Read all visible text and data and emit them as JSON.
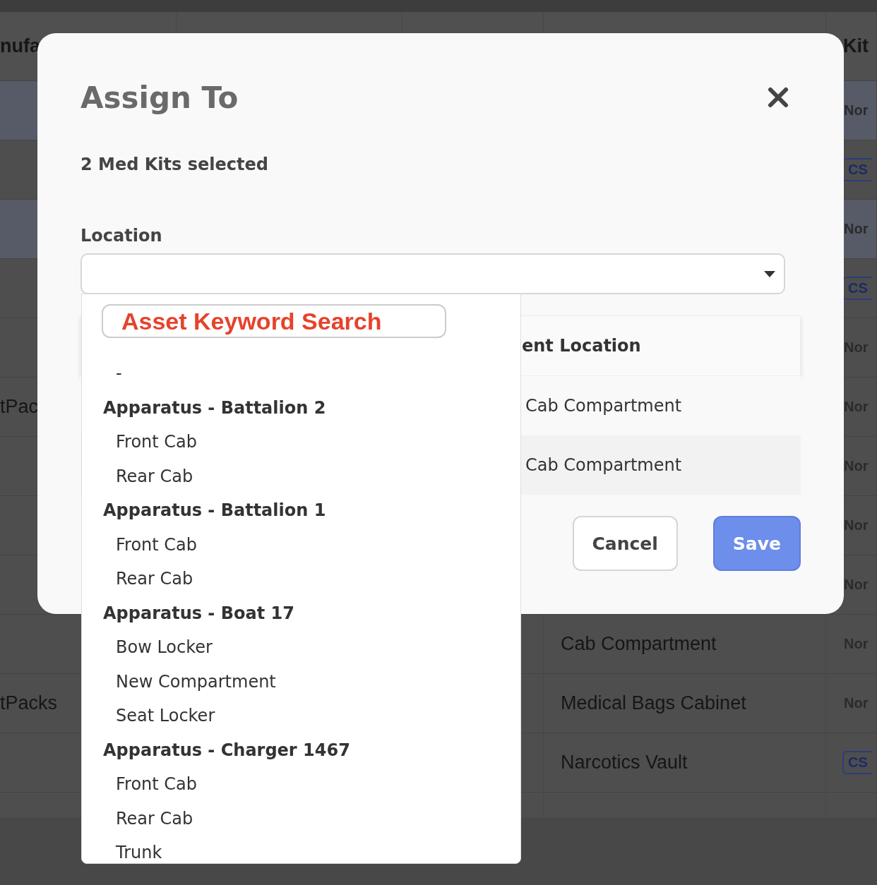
{
  "background_table": {
    "header": {
      "column_1": "nufa",
      "column_5": "Kit"
    },
    "rows": [
      {
        "highlighted": true,
        "column_5": {
          "kind": "text",
          "text": "Nor"
        }
      },
      {
        "highlighted": false,
        "column_5": {
          "kind": "badge",
          "text": "CS"
        }
      },
      {
        "highlighted": true,
        "column_5": {
          "kind": "text",
          "text": "Nor"
        }
      },
      {
        "highlighted": false,
        "column_5": {
          "kind": "badge",
          "text": "CS"
        }
      },
      {
        "highlighted": false,
        "column_5": {
          "kind": "text",
          "text": "Nor"
        }
      },
      {
        "highlighted": false,
        "column_1": "tPac",
        "column_5": {
          "kind": "text",
          "text": "Nor"
        }
      },
      {
        "highlighted": false,
        "column_5": {
          "kind": "text",
          "text": "Nor"
        }
      },
      {
        "highlighted": false,
        "column_5": {
          "kind": "text",
          "text": "Nor"
        }
      },
      {
        "highlighted": false,
        "column_5": {
          "kind": "text",
          "text": "Nor"
        }
      },
      {
        "highlighted": false,
        "column_4": "Cab Compartment",
        "column_5": {
          "kind": "text",
          "text": "Nor"
        }
      },
      {
        "highlighted": false,
        "column_1": "tPacks",
        "column_4": "Medical Bags Cabinet",
        "column_5": {
          "kind": "text",
          "text": "Nor"
        }
      },
      {
        "highlighted": false,
        "column_4": "Narcotics Vault",
        "column_5": {
          "kind": "badge",
          "text": "CS"
        }
      }
    ]
  },
  "modal": {
    "title": "Assign To",
    "subtitle": "2 Med Kits selected",
    "location": {
      "label": "Location",
      "expanded": true
    },
    "dropdown": {
      "search": {
        "placeholder": "Asset Keyword Search"
      },
      "options": [
        {
          "label": "-"
        },
        {
          "label": "Apparatus - Battalion 2",
          "children": [
            {
              "label": "Front Cab"
            },
            {
              "label": "Rear Cab"
            }
          ]
        },
        {
          "label": "Apparatus - Battalion 1",
          "children": [
            {
              "label": "Front Cab"
            },
            {
              "label": "Rear Cab"
            }
          ]
        },
        {
          "label": "Apparatus - Boat 17",
          "children": [
            {
              "label": "Bow Locker"
            },
            {
              "label": "New Compartment"
            },
            {
              "label": "Seat Locker"
            }
          ]
        },
        {
          "label": "Apparatus - Charger 1467",
          "children": [
            {
              "label": "Front Cab"
            },
            {
              "label": "Rear Cab"
            },
            {
              "label": "Trunk"
            }
          ]
        }
      ]
    },
    "table": {
      "header": "ent Location",
      "rows": [
        "Cab Compartment",
        "Cab Compartment"
      ]
    },
    "buttons": [
      {
        "label": "Cancel",
        "kind": "secondary"
      },
      {
        "label": "Save",
        "kind": "primary"
      }
    ]
  }
}
